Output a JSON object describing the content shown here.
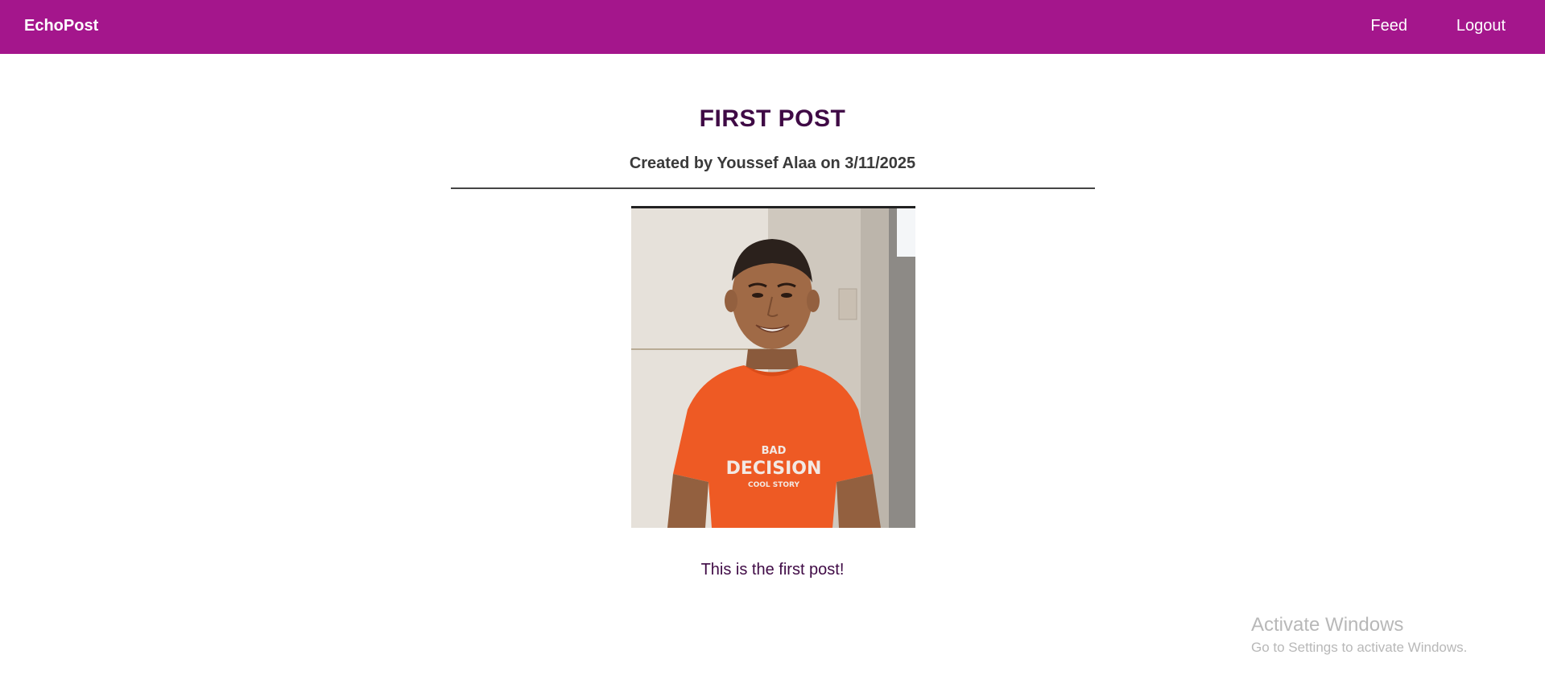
{
  "header": {
    "brand": "EchoPost",
    "nav": {
      "feed": "Feed",
      "logout": "Logout"
    },
    "color": "#a4168c"
  },
  "post": {
    "title": "FIRST POST",
    "meta": "Created by Youssef Alaa on 3/11/2025",
    "body": "This is the first post!",
    "image_alt": "Young man in an orange t-shirt smiling"
  },
  "watermark": {
    "title": "Activate Windows",
    "subtitle": "Go to Settings to activate Windows."
  },
  "colors": {
    "title": "#3f0a45",
    "meta": "#3a3a3a",
    "shirt": "#ee5a24"
  }
}
